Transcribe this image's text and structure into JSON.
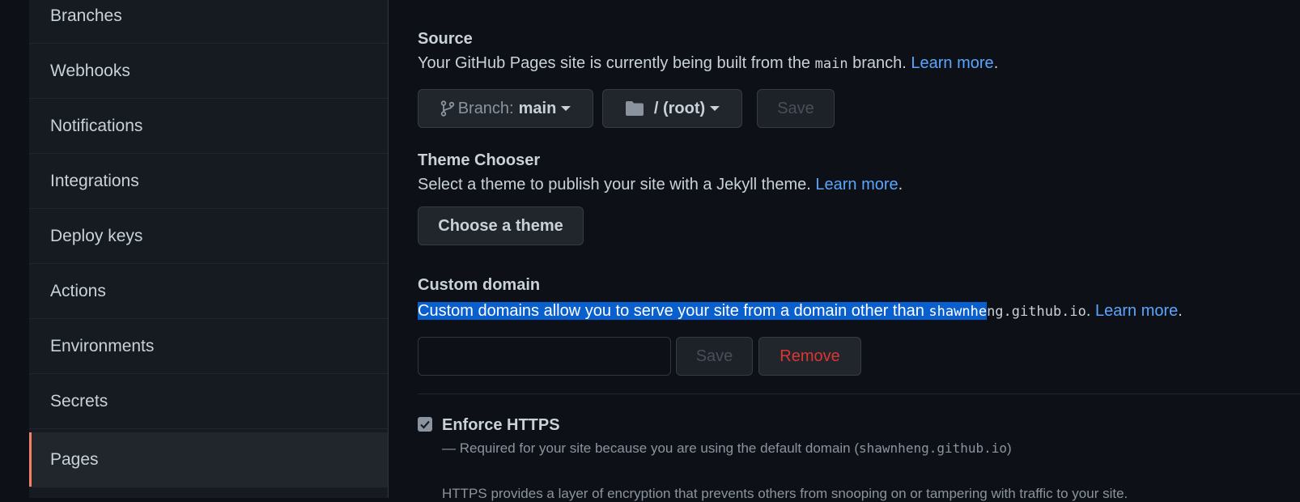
{
  "sidebar": {
    "items": [
      {
        "label": "Branches"
      },
      {
        "label": "Webhooks"
      },
      {
        "label": "Notifications"
      },
      {
        "label": "Integrations"
      },
      {
        "label": "Deploy keys"
      },
      {
        "label": "Actions"
      },
      {
        "label": "Environments"
      },
      {
        "label": "Secrets"
      },
      {
        "label": "Pages",
        "active": true
      }
    ]
  },
  "source": {
    "title": "Source",
    "desc_prefix": "Your GitHub Pages site is currently being built from the ",
    "desc_branch_code": "main",
    "desc_suffix": " branch. ",
    "learn_more": "Learn more",
    "period": ".",
    "branch_label": "Branch:",
    "branch_value": "main",
    "folder_value": "/ (root)",
    "save_label": "Save"
  },
  "theme": {
    "title": "Theme Chooser",
    "desc": "Select a theme to publish your site with a Jekyll theme. ",
    "learn_more": "Learn more",
    "period": ".",
    "button_label": "Choose a theme"
  },
  "custom_domain": {
    "title": "Custom domain",
    "desc_selected": "Custom domains allow you to serve your site from a domain other than ",
    "desc_code_selected": "shawnhe",
    "desc_code_rest": "ng.github.io",
    "period_before_link": ". ",
    "learn_more": "Learn more",
    "period": ".",
    "input_value": "",
    "save_label": "Save",
    "remove_label": "Remove"
  },
  "https": {
    "checked": true,
    "title": "Enforce HTTPS",
    "note_prefix": "— Required for your site because you are using the default domain (",
    "note_code": "shawnheng.github.io",
    "note_suffix": ")",
    "info": "HTTPS provides a layer of encryption that prevents others from snooping on or tampering with traffic to your site."
  },
  "colors": {
    "background": "#0d1117",
    "sidebar": "#161b22",
    "link": "#58a6ff",
    "active_indicator": "#f78166",
    "danger": "#da3633",
    "selection": "#0a5fcf"
  }
}
